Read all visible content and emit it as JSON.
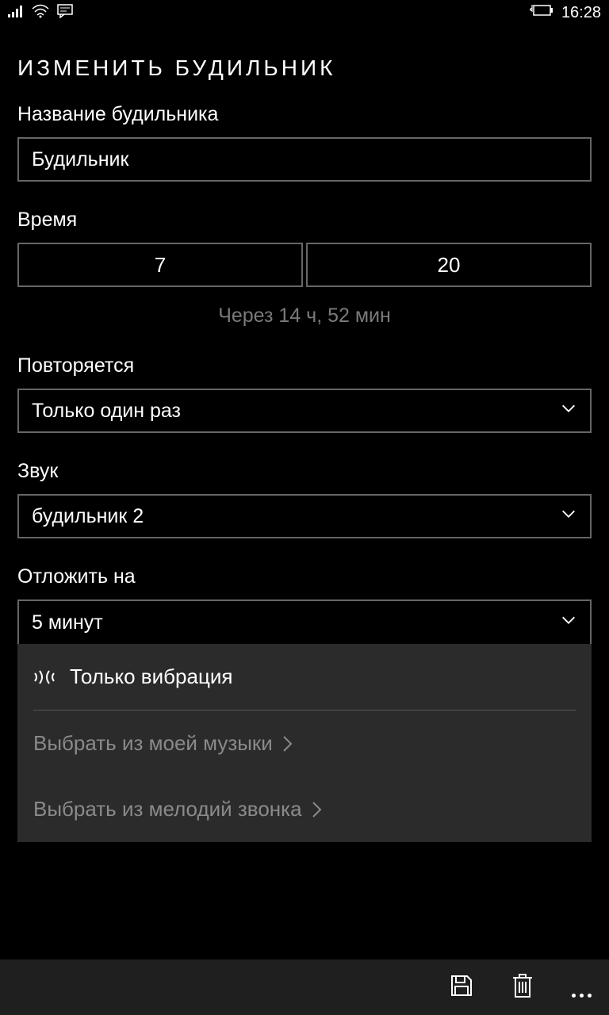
{
  "status": {
    "time": "16:28"
  },
  "page": {
    "title": "ИЗМЕНИТЬ БУДИЛЬНИК"
  },
  "alarm_name": {
    "label": "Название будильника",
    "value": "Будильник"
  },
  "time": {
    "label": "Время",
    "hour": "7",
    "minute": "20",
    "remaining": "Через 14 ч, 52 мин"
  },
  "repeat": {
    "label": "Повторяется",
    "value": "Только один раз"
  },
  "sound": {
    "label": "Звук",
    "value": "будильник 2"
  },
  "snooze": {
    "label": "Отложить на",
    "value": "5 минут"
  },
  "popup": {
    "vibrate_only": "Только вибрация",
    "pick_music": "Выбрать из моей музыки",
    "pick_ringtone": "Выбрать из мелодий звонка"
  }
}
